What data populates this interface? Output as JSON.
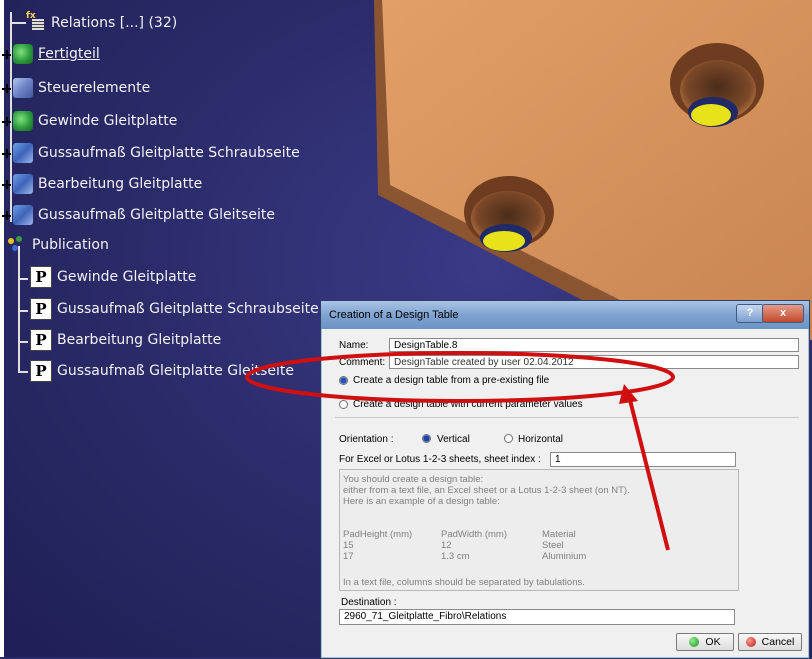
{
  "tree": {
    "relations": "Relations [...] (32)",
    "fertigteil": "Fertigteil",
    "steuerelemente": "Steuerelemente",
    "gewinde": "Gewinde Gleitplatte",
    "guss_schraub": "Gussaufmaß Gleitplatte Schraubseite",
    "bearbeitung": "Bearbeitung Gleitplatte",
    "guss_gleit": "Gussaufmaß Gleitplatte Gleitseite",
    "publication": "Publication",
    "pub_gewinde": "Gewinde Gleitplatte",
    "pub_guss_schraub": "Gussaufmaß Gleitplatte Schraubseite",
    "pub_bearbeitung": "Bearbeitung Gleitplatte",
    "pub_guss_gleit": "Gussaufmaß Gleitplatte Gleitseite"
  },
  "dialog": {
    "title": "Creation of a Design Table",
    "help": "?",
    "close": "x",
    "name_label": "Name:",
    "name_value": "DesignTable.8",
    "comment_label": "Comment:",
    "comment_value": "DesignTable created by user 02.04.2012",
    "option_preexisting": "Create a design table from a pre-existing file",
    "option_current": "Create a design table with current parameter values",
    "orientation_label": "Orientation :",
    "vertical": "Vertical",
    "horizontal": "Horizontal",
    "sheet_label": "For Excel or Lotus 1-2-3 sheets, sheet index :",
    "sheet_value": "1",
    "info": {
      "l1": "You should create a design table:",
      "l2": "either from a text file, an Excel sheet or a Lotus 1-2-3 sheet (on NT).",
      "l3": "Here is an example of a design table:",
      "h1": "PadHeight (mm)",
      "h2": "PadWidth (mm)",
      "h3": "Material",
      "r1c1": "15",
      "r1c2": "12",
      "r1c3": "Steel",
      "r2c1": "17",
      "r2c2": "1.3 cm",
      "r2c3": "Aluminium",
      "footer": "In a text file, columns should be separated by tabulations."
    },
    "destination_label": "Destination :",
    "destination_value": "2960_71_Gleitplatte_Fibro\\Relations",
    "ok": "OK",
    "cancel": "Cancel"
  },
  "colors": {
    "background": "#2a2a68",
    "plate": "#d08a55",
    "annotation_red": "#d01010"
  }
}
